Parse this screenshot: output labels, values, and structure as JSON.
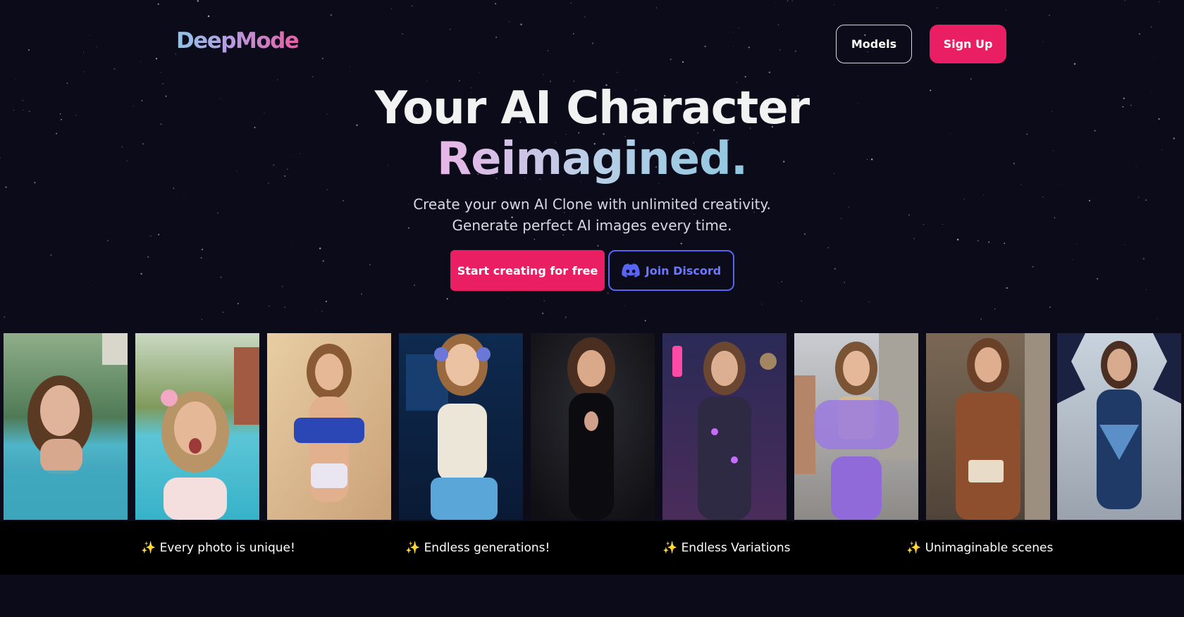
{
  "brand": {
    "name": "DeepMode"
  },
  "nav": {
    "models_label": "Models",
    "signup_label": "Sign Up"
  },
  "hero": {
    "title_line1": "Your AI Character",
    "title_line2": "Reimagined.",
    "subtitle_line1": "Create your own AI Clone with unlimited creativity.",
    "subtitle_line2": "Generate perfect AI images every time.",
    "cta_primary": "Start creating for free",
    "cta_secondary": "Join Discord"
  },
  "gallery": {
    "photos": [
      {
        "scene": "woman in swimming pool"
      },
      {
        "scene": "woman taking selfie by resort pool"
      },
      {
        "scene": "woman in blue sporty bikini by sand wall"
      },
      {
        "scene": "woman with headphones in gaming room"
      },
      {
        "scene": "woman in black latex suit"
      },
      {
        "scene": "woman in futuristic armor on neon street"
      },
      {
        "scene": "woman in purple puffer jacket on street"
      },
      {
        "scene": "woman in brown suit holding clutch"
      },
      {
        "scene": "woman in blue patterned dress by hexagon wall"
      }
    ],
    "captions": [
      "✨ Every photo is unique!",
      "✨ Endless generations!",
      "✨ Endless Variations",
      "✨ Unimaginable scenes"
    ]
  },
  "colors": {
    "background": "#0b0b1a",
    "accent": "#e91e63",
    "discord": "#5865f2",
    "caption_bar": "#000000"
  },
  "icons": {
    "discord": "discord-icon"
  }
}
